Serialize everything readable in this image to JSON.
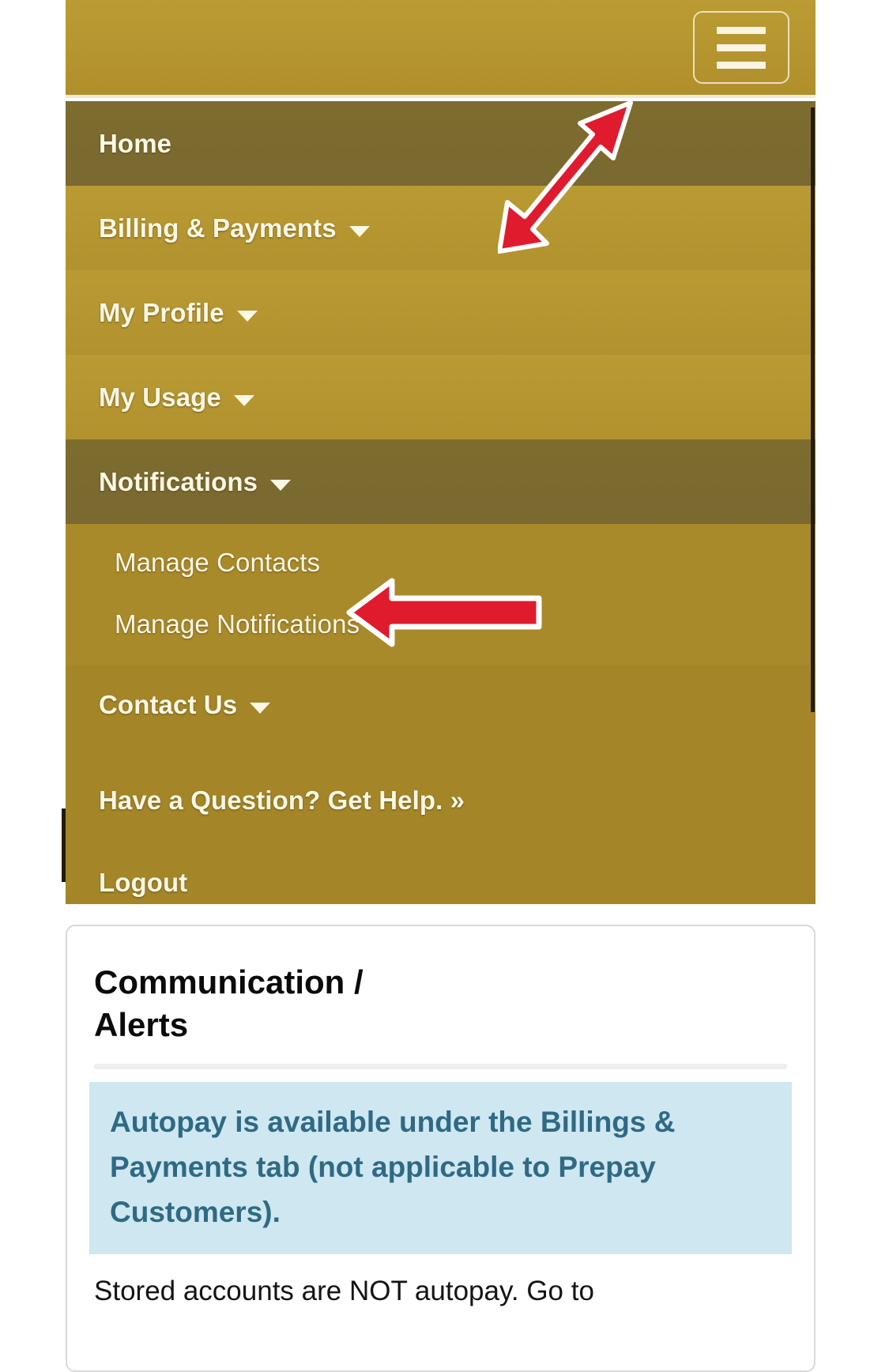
{
  "header": {
    "menu_button_label": "Menu",
    "icon": "hamburger-menu-icon",
    "background_color": "#b5952f"
  },
  "nav": {
    "items": [
      {
        "label": "Home",
        "active": true,
        "has_caret": false
      },
      {
        "label": "Billing & Payments",
        "active": false,
        "has_caret": true
      },
      {
        "label": "My Profile",
        "active": false,
        "has_caret": true
      },
      {
        "label": "My Usage",
        "active": false,
        "has_caret": true
      },
      {
        "label": "Notifications",
        "active": true,
        "has_caret": true
      }
    ],
    "notifications_submenu": [
      {
        "label": "Manage Contacts"
      },
      {
        "label": "Manage Notifications"
      }
    ],
    "contact_us": {
      "label": "Contact Us",
      "has_caret": true
    },
    "help_link": {
      "label": "Have a Question? Get Help. »"
    },
    "logout": {
      "label": "Logout"
    },
    "colors": {
      "normal": "#b1922e",
      "active": "#7a6930",
      "submenu": "#a98a2a",
      "text": "#fdf7e6"
    }
  },
  "card": {
    "title_line1": "Communication /",
    "title_line2": "Alerts",
    "alert": {
      "text": "Autopay is available under the Billings & Payments tab (not applicable to Prepay Customers).",
      "background_color": "#cfe7f1",
      "text_color": "#2f6a84"
    },
    "note": "Stored accounts are NOT autopay. Go to"
  },
  "annotations": {
    "arrow_color": "#e01b2e",
    "arrow_outline_color": "#ffffff",
    "arrows": [
      {
        "name": "arrow-to-hamburger",
        "direction": "up-right",
        "points_at": "hamburger-menu-button"
      },
      {
        "name": "arrow-to-manage-contacts",
        "direction": "left",
        "points_at": "Manage Contacts"
      }
    ]
  }
}
